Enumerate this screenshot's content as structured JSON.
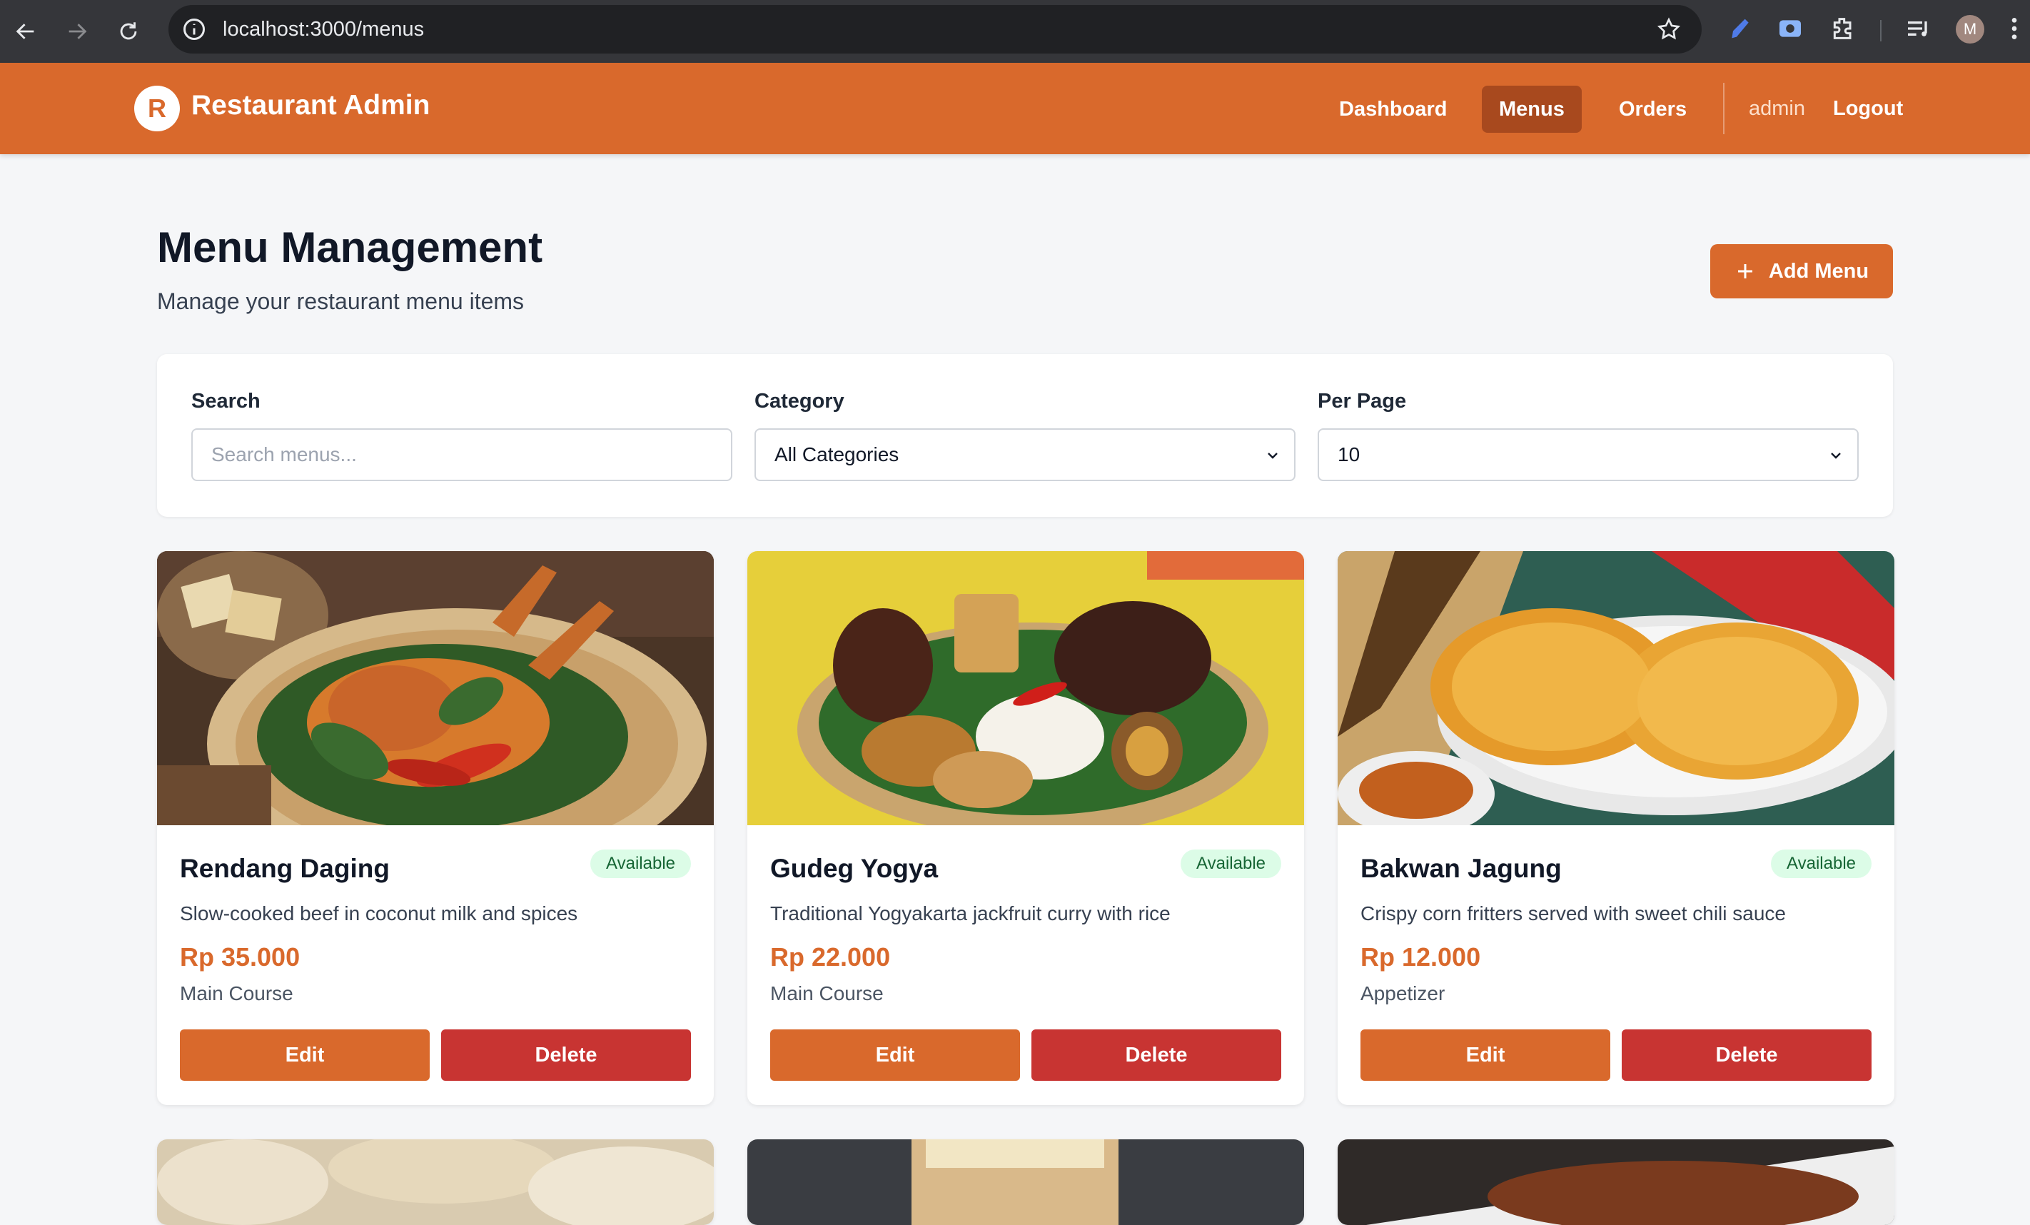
{
  "browser": {
    "url": "localhost:3000/menus",
    "profile_initial": "M"
  },
  "header": {
    "logo_letter": "R",
    "brand": "Restaurant Admin",
    "nav": [
      {
        "label": "Dashboard",
        "active": false
      },
      {
        "label": "Menus",
        "active": true
      },
      {
        "label": "Orders",
        "active": false
      }
    ],
    "user": "admin",
    "logout": "Logout"
  },
  "page": {
    "title": "Menu Management",
    "subtitle": "Manage your restaurant menu items",
    "add_button": "Add Menu"
  },
  "filters": {
    "search_label": "Search",
    "search_placeholder": "Search menus...",
    "category_label": "Category",
    "category_value": "All Categories",
    "per_page_label": "Per Page",
    "per_page_value": "10"
  },
  "menus": [
    {
      "name": "Rendang Daging",
      "status": "Available",
      "description": "Slow-cooked beef in coconut milk and spices",
      "price": "Rp 35.000",
      "category": "Main Course",
      "edit": "Edit",
      "delete": "Delete"
    },
    {
      "name": "Gudeg Yogya",
      "status": "Available",
      "description": "Traditional Yogyakarta jackfruit curry with rice",
      "price": "Rp 22.000",
      "category": "Main Course",
      "edit": "Edit",
      "delete": "Delete"
    },
    {
      "name": "Bakwan Jagung",
      "status": "Available",
      "description": "Crispy corn fritters served with sweet chili sauce",
      "price": "Rp 12.000",
      "category": "Appetizer",
      "edit": "Edit",
      "delete": "Delete"
    }
  ],
  "colors": {
    "brand": "#d9692c",
    "danger": "#c83432",
    "available_bg": "#dcfce7",
    "available_text": "#166534"
  }
}
